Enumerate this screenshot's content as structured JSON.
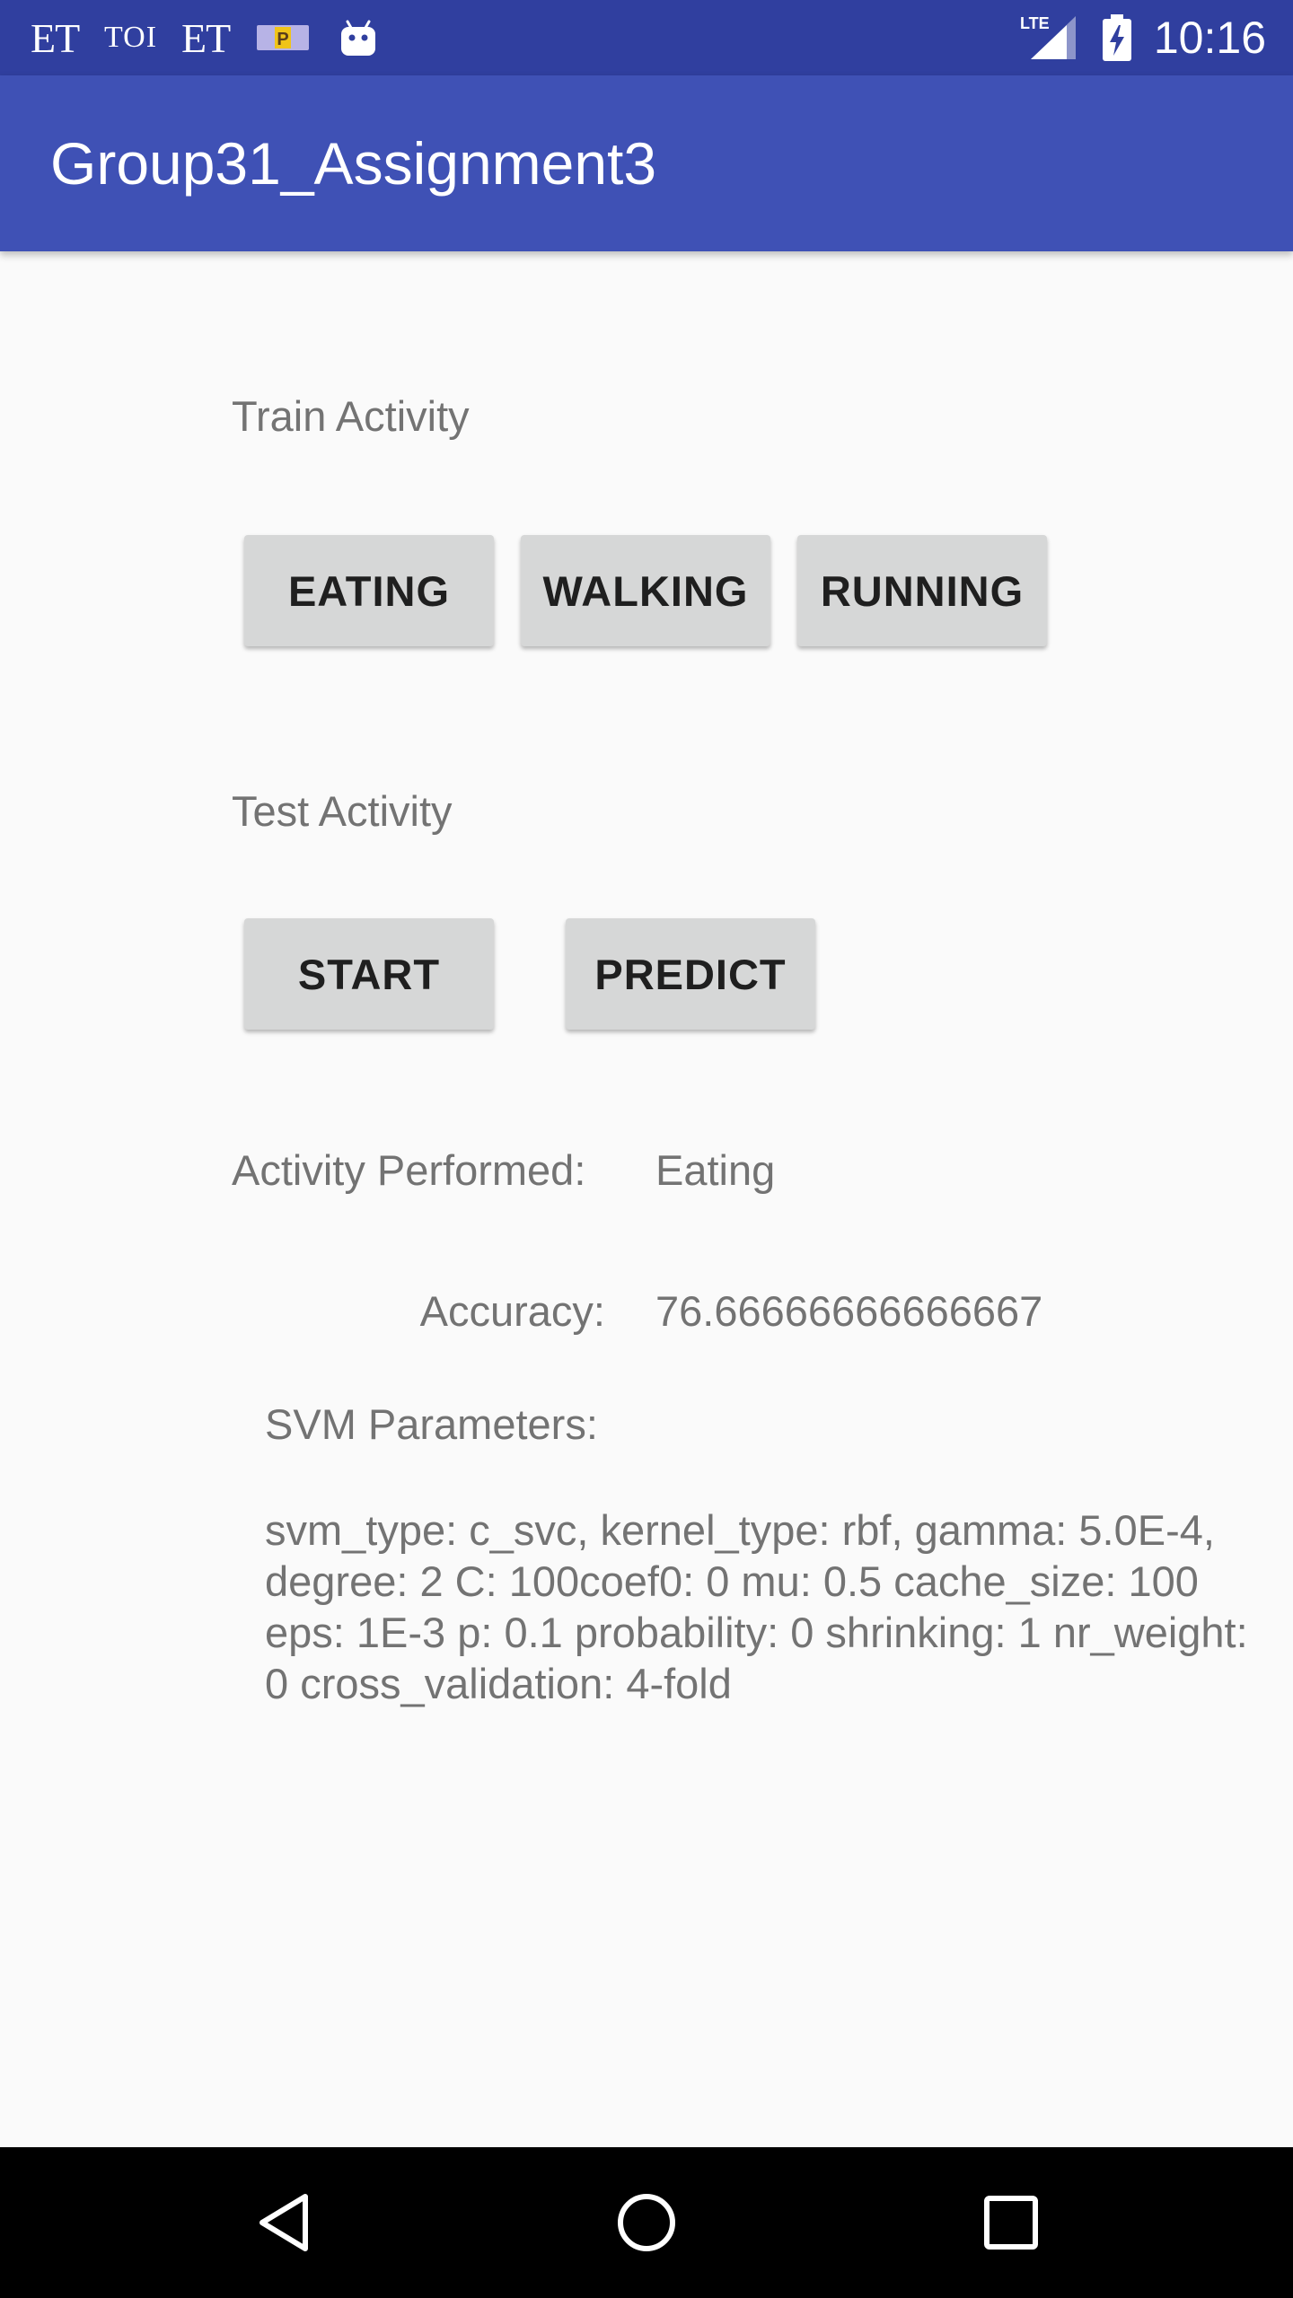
{
  "status_bar": {
    "notifications": [
      "ET",
      "TOI",
      "ET"
    ],
    "network": "LTE",
    "time": "10:16"
  },
  "app_bar": {
    "title": "Group31_Assignment3"
  },
  "train": {
    "heading": "Train Activity",
    "buttons": [
      "EATING",
      "WALKING",
      "RUNNING"
    ]
  },
  "test": {
    "heading": "Test Activity",
    "start_label": "START",
    "predict_label": "PREDICT"
  },
  "result": {
    "activity_label": "Activity Performed:",
    "activity_value": "Eating",
    "accuracy_label": "Accuracy:",
    "accuracy_value": "76.66666666666667"
  },
  "svm": {
    "heading": "SVM Parameters:",
    "text": "svm_type: c_svc, kernel_type: rbf, gamma: 5.0E-4, degree: 2 C: 100coef0: 0 mu: 0.5 cache_size: 100 eps: 1E-3 p: 0.1 probability: 0 shrinking: 1 nr_weight: 0 cross_validation: 4-fold"
  },
  "colors": {
    "status_bar": "#303f9f",
    "app_bar": "#3f51b5",
    "background": "#fafafa",
    "button": "#d6d7d7",
    "secondary_text": "#737373"
  }
}
